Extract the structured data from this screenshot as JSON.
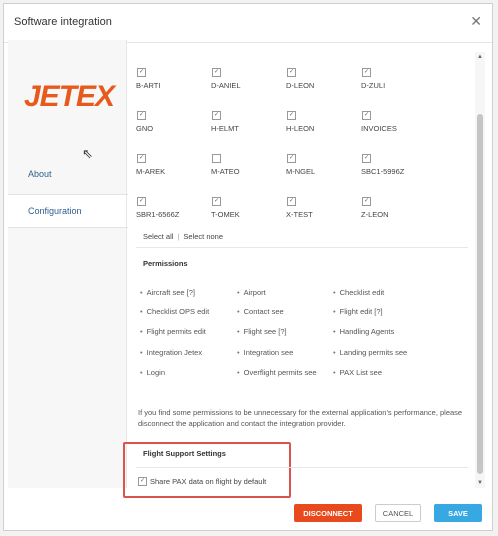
{
  "dialog": {
    "title": "Software integration"
  },
  "sidebar": {
    "logo": "JETEX",
    "items": [
      {
        "label": "About"
      },
      {
        "label": "Configuration"
      }
    ]
  },
  "accounts": [
    {
      "label": "B-ARTI",
      "checked": true
    },
    {
      "label": "D-ANIEL",
      "checked": true
    },
    {
      "label": "D-LEON",
      "checked": true
    },
    {
      "label": "D-ZULI",
      "checked": true
    },
    {
      "label": "GNO",
      "checked": true
    },
    {
      "label": "H-ELMT",
      "checked": true
    },
    {
      "label": "H-LEON",
      "checked": true
    },
    {
      "label": "INVOICES",
      "checked": true
    },
    {
      "label": "M-AREK",
      "checked": true
    },
    {
      "label": "M-ATEO",
      "checked": false
    },
    {
      "label": "M-NGEL",
      "checked": true
    },
    {
      "label": "SBC1-5996Z",
      "checked": true
    },
    {
      "label": "SBR1-6566Z",
      "checked": true
    },
    {
      "label": "T-OMEK",
      "checked": true
    },
    {
      "label": "X-TEST",
      "checked": true
    },
    {
      "label": "Z-LEON",
      "checked": true
    }
  ],
  "select": {
    "all": "Select all",
    "none": "Select none"
  },
  "permissions": {
    "title": "Permissions",
    "items": [
      [
        "Aircraft see [?]",
        "Airport",
        "Checklist edit"
      ],
      [
        "Checklist OPS edit",
        "Contact see",
        "Flight edit [?]"
      ],
      [
        "Flight permits edit",
        "Flight see [?]",
        "Handling Agents"
      ],
      [
        "Integration Jetex",
        "Integration see",
        "Landing permits see"
      ],
      [
        "Login",
        "Overflight permits see",
        "PAX List see"
      ]
    ]
  },
  "note": "If you find some permissions to be unnecessary for the external application's performance, please disconnect the application and contact the integration provider.",
  "flight_support": {
    "title": "Flight Support Settings",
    "option_label": "Share PAX data on flight by default",
    "option_checked": true
  },
  "buttons": {
    "disconnect": "DISCONNECT",
    "cancel": "CANCEL",
    "save": "SAVE"
  },
  "colors": {
    "brand": "#e85a1b",
    "disconnect": "#e84a1e",
    "save": "#37a8e2",
    "highlight": "#d9534f"
  }
}
